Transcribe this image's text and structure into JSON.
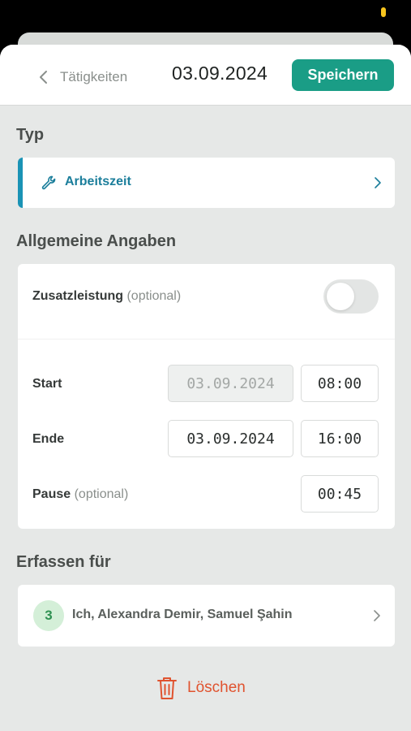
{
  "header": {
    "back_label": "Tätigkeiten",
    "date": "03.09.2024",
    "save_label": "Speichern"
  },
  "type_section": {
    "title": "Typ",
    "value": "Arbeitszeit",
    "icon": "wrench-icon"
  },
  "general": {
    "title": "Allgemeine Angaben",
    "extra_service_label": "Zusatzleistung",
    "extra_service_optional": "(optional)",
    "extra_service_enabled": false,
    "start_label": "Start",
    "start_date": "03.09.2024",
    "start_time": "08:00",
    "end_label": "Ende",
    "end_date": "03.09.2024",
    "end_time": "16:00",
    "pause_label": "Pause",
    "pause_optional": "(optional)",
    "pause_value": "00:45"
  },
  "assign": {
    "title": "Erfassen für",
    "count": "3",
    "people": "Ich, Alexandra Demir, Samuel Şahin"
  },
  "delete_label": "Löschen",
  "colors": {
    "accent_teal": "#1a9d86",
    "type_blue": "#1a93b5",
    "delete_red": "#e0532f",
    "badge_green": "#2f9152"
  }
}
